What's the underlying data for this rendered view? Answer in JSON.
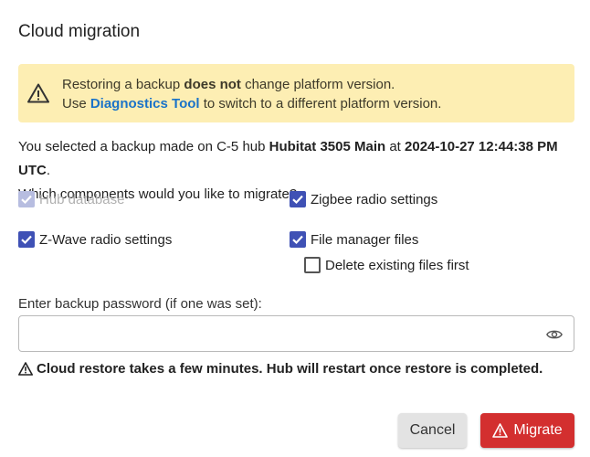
{
  "dialog": {
    "title": "Cloud migration"
  },
  "alert": {
    "icon": "warning-icon",
    "line1_pre": "Restoring a backup ",
    "line1_bold": "does not",
    "line1_post": " change platform version.",
    "line2_pre": "Use ",
    "line2_link": "Diagnostics Tool",
    "line2_post": " to switch to a different platform version.",
    "background": "#fdeeb3"
  },
  "info": {
    "pre": "You selected a backup made on C-5 hub ",
    "hub_name": "Hubitat 3505 Main",
    "mid": " at ",
    "datetime": "2024-10-27 12:44:38 PM UTC",
    "post": ".",
    "question": "Which components would you like to migrate?"
  },
  "components": {
    "hub_database": {
      "label": "Hub database",
      "checked": true,
      "disabled": true
    },
    "zigbee": {
      "label": "Zigbee radio settings",
      "checked": true
    },
    "zwave": {
      "label": "Z-Wave radio settings",
      "checked": true
    },
    "file_manager": {
      "label": "File manager files",
      "checked": true
    },
    "delete_existing": {
      "label": "Delete existing files first",
      "checked": false
    }
  },
  "password": {
    "label": "Enter backup password (if one was set):",
    "value": "",
    "placeholder": "",
    "toggle_icon": "eye-icon"
  },
  "notice": {
    "icon": "warning-icon",
    "text": "Cloud restore takes a few minutes. Hub will restart once restore is completed."
  },
  "actions": {
    "cancel_label": "Cancel",
    "migrate_label": "Migrate",
    "migrate_color": "#d32f2f",
    "checkbox_color": "#3f51b5"
  }
}
